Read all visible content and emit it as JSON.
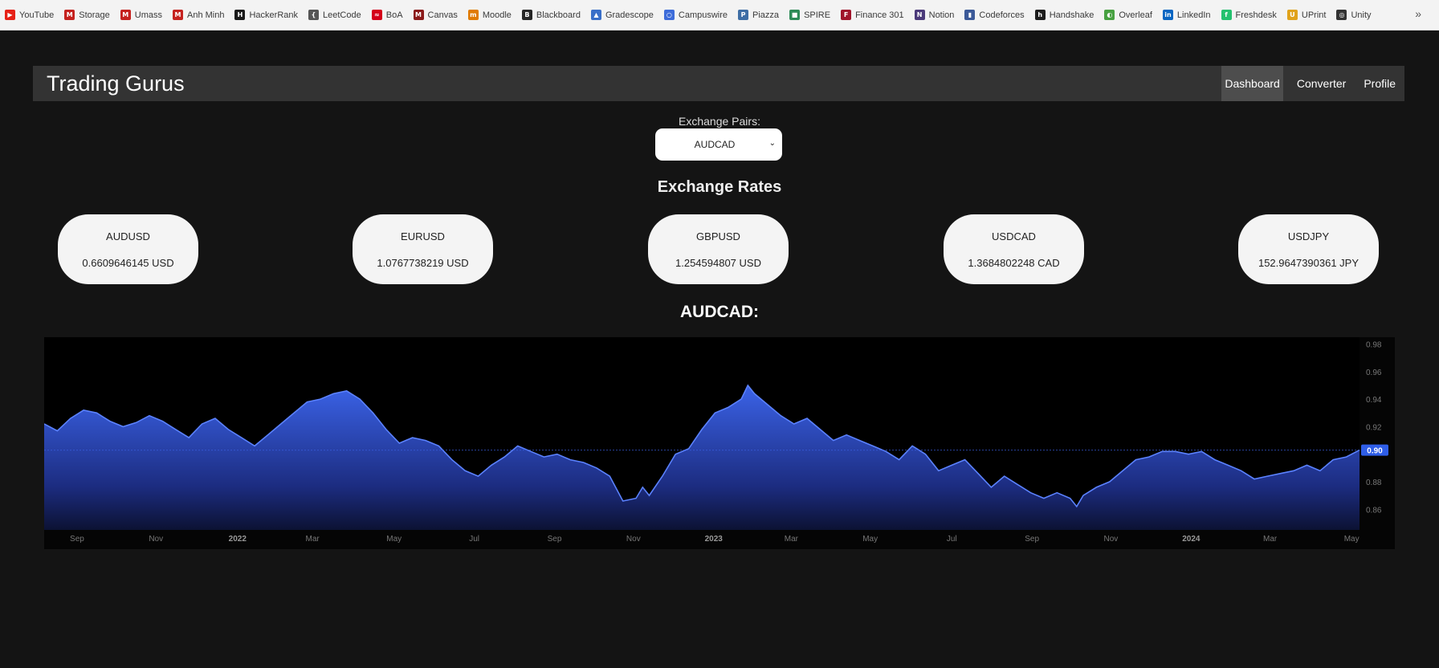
{
  "bookmarks": [
    {
      "label": "YouTube",
      "icon": "youtube-icon",
      "color": "#e62117",
      "glyph": "▶"
    },
    {
      "label": "Storage",
      "icon": "gmail-icon",
      "color": "#c5221f",
      "glyph": "M"
    },
    {
      "label": "Umass",
      "icon": "gmail-icon",
      "color": "#c5221f",
      "glyph": "M"
    },
    {
      "label": "Anh Minh",
      "icon": "gmail-icon",
      "color": "#c5221f",
      "glyph": "M"
    },
    {
      "label": "HackerRank",
      "icon": "hackerrank-icon",
      "color": "#1a1a1a",
      "glyph": "H"
    },
    {
      "label": "LeetCode",
      "icon": "leetcode-icon",
      "color": "#555555",
      "glyph": "{"
    },
    {
      "label": "BoA",
      "icon": "boa-icon",
      "color": "#d4001a",
      "glyph": "≈"
    },
    {
      "label": "Canvas",
      "icon": "canvas-icon",
      "color": "#8b1a1a",
      "glyph": "M"
    },
    {
      "label": "Moodle",
      "icon": "moodle-icon",
      "color": "#e07b00",
      "glyph": "m"
    },
    {
      "label": "Blackboard",
      "icon": "blackboard-icon",
      "color": "#262626",
      "glyph": "B"
    },
    {
      "label": "Gradescope",
      "icon": "gradescope-icon",
      "color": "#3a6fc8",
      "glyph": "▲"
    },
    {
      "label": "Campuswire",
      "icon": "campuswire-icon",
      "color": "#3d6cd9",
      "glyph": "○"
    },
    {
      "label": "Piazza",
      "icon": "piazza-icon",
      "color": "#3e6ea5",
      "glyph": "P"
    },
    {
      "label": "SPIRE",
      "icon": "spire-icon",
      "color": "#2e8b57",
      "glyph": "■"
    },
    {
      "label": "Finance 301",
      "icon": "finance-icon",
      "color": "#a0142b",
      "glyph": "F"
    },
    {
      "label": "Notion",
      "icon": "notion-icon",
      "color": "#4b3a7a",
      "glyph": "N"
    },
    {
      "label": "Codeforces",
      "icon": "codeforces-icon",
      "color": "#3b5998",
      "glyph": "▮"
    },
    {
      "label": "Handshake",
      "icon": "handshake-icon",
      "color": "#1d1d1d",
      "glyph": "h"
    },
    {
      "label": "Overleaf",
      "icon": "overleaf-icon",
      "color": "#47a141",
      "glyph": "◐"
    },
    {
      "label": "LinkedIn",
      "icon": "linkedin-icon",
      "color": "#0a66c2",
      "glyph": "in"
    },
    {
      "label": "Freshdesk",
      "icon": "freshdesk-icon",
      "color": "#25c16f",
      "glyph": "f"
    },
    {
      "label": "UPrint",
      "icon": "uprint-icon",
      "color": "#e0a21a",
      "glyph": "U"
    },
    {
      "label": "Unity",
      "icon": "unity-icon",
      "color": "#333333",
      "glyph": "◎"
    }
  ],
  "more_label": "»",
  "app": {
    "title": "Trading Gurus",
    "nav": [
      "Dashboard",
      "Converter",
      "Profile"
    ],
    "active_nav": "Dashboard"
  },
  "exchange": {
    "label": "Exchange Pairs:",
    "selected": "AUDCAD"
  },
  "rates_title": "Exchange Rates",
  "rates": [
    {
      "pair": "AUDUSD",
      "value": "0.6609646145 USD"
    },
    {
      "pair": "EURUSD",
      "value": "1.0767738219 USD"
    },
    {
      "pair": "GBPUSD",
      "value": "1.254594807 USD"
    },
    {
      "pair": "USDCAD",
      "value": "1.3684802248 CAD"
    },
    {
      "pair": "USDJPY",
      "value": "152.9647390361 JPY"
    }
  ],
  "chart_title": "AUDCAD:",
  "colors": {
    "accent": "#3b63e8",
    "line": "#5b82ff",
    "last_price_badge": "#2f5ee8"
  },
  "chart_data": {
    "type": "area",
    "title": "AUDCAD:",
    "ylim": [
      0.845,
      0.985
    ],
    "y_ticks": [
      0.86,
      0.88,
      0.9,
      0.92,
      0.94,
      0.96,
      0.98
    ],
    "y_tick_labels": [
      "0.86",
      "0.88",
      "",
      "0.92",
      "0.94",
      "0.96",
      "0.98"
    ],
    "last_value_label": "0.90",
    "last_value": 0.903,
    "x_ticks": [
      {
        "label": "Sep",
        "bold": false,
        "pos": 0.025
      },
      {
        "label": "Nov",
        "bold": false,
        "pos": 0.085
      },
      {
        "label": "2022",
        "bold": true,
        "pos": 0.147
      },
      {
        "label": "Mar",
        "bold": false,
        "pos": 0.204
      },
      {
        "label": "May",
        "bold": false,
        "pos": 0.266
      },
      {
        "label": "Jul",
        "bold": false,
        "pos": 0.327
      },
      {
        "label": "Sep",
        "bold": false,
        "pos": 0.388
      },
      {
        "label": "Nov",
        "bold": false,
        "pos": 0.448
      },
      {
        "label": "2023",
        "bold": true,
        "pos": 0.509
      },
      {
        "label": "Mar",
        "bold": false,
        "pos": 0.568
      },
      {
        "label": "May",
        "bold": false,
        "pos": 0.628
      },
      {
        "label": "Jul",
        "bold": false,
        "pos": 0.69
      },
      {
        "label": "Sep",
        "bold": false,
        "pos": 0.751
      },
      {
        "label": "Nov",
        "bold": false,
        "pos": 0.811
      },
      {
        "label": "2024",
        "bold": true,
        "pos": 0.872
      },
      {
        "label": "Mar",
        "bold": false,
        "pos": 0.932
      },
      {
        "label": "May",
        "bold": false,
        "pos": 0.994
      }
    ],
    "series": [
      {
        "values": [
          [
            0.0,
            0.922
          ],
          [
            0.01,
            0.917
          ],
          [
            0.02,
            0.926
          ],
          [
            0.03,
            0.932
          ],
          [
            0.04,
            0.93
          ],
          [
            0.05,
            0.924
          ],
          [
            0.06,
            0.92
          ],
          [
            0.07,
            0.923
          ],
          [
            0.08,
            0.928
          ],
          [
            0.09,
            0.924
          ],
          [
            0.1,
            0.918
          ],
          [
            0.11,
            0.912
          ],
          [
            0.12,
            0.922
          ],
          [
            0.13,
            0.926
          ],
          [
            0.14,
            0.918
          ],
          [
            0.15,
            0.912
          ],
          [
            0.16,
            0.906
          ],
          [
            0.17,
            0.914
          ],
          [
            0.18,
            0.922
          ],
          [
            0.19,
            0.93
          ],
          [
            0.2,
            0.938
          ],
          [
            0.21,
            0.94
          ],
          [
            0.22,
            0.944
          ],
          [
            0.23,
            0.946
          ],
          [
            0.24,
            0.94
          ],
          [
            0.25,
            0.93
          ],
          [
            0.26,
            0.918
          ],
          [
            0.27,
            0.908
          ],
          [
            0.28,
            0.912
          ],
          [
            0.29,
            0.91
          ],
          [
            0.3,
            0.906
          ],
          [
            0.31,
            0.896
          ],
          [
            0.32,
            0.888
          ],
          [
            0.33,
            0.884
          ],
          [
            0.34,
            0.892
          ],
          [
            0.35,
            0.898
          ],
          [
            0.36,
            0.906
          ],
          [
            0.37,
            0.902
          ],
          [
            0.38,
            0.898
          ],
          [
            0.39,
            0.9
          ],
          [
            0.4,
            0.896
          ],
          [
            0.41,
            0.894
          ],
          [
            0.42,
            0.89
          ],
          [
            0.43,
            0.884
          ],
          [
            0.44,
            0.866
          ],
          [
            0.45,
            0.868
          ],
          [
            0.455,
            0.876
          ],
          [
            0.46,
            0.87
          ],
          [
            0.47,
            0.884
          ],
          [
            0.48,
            0.9
          ],
          [
            0.49,
            0.904
          ],
          [
            0.5,
            0.918
          ],
          [
            0.51,
            0.93
          ],
          [
            0.52,
            0.934
          ],
          [
            0.53,
            0.94
          ],
          [
            0.535,
            0.95
          ],
          [
            0.54,
            0.944
          ],
          [
            0.55,
            0.936
          ],
          [
            0.56,
            0.928
          ],
          [
            0.57,
            0.922
          ],
          [
            0.58,
            0.926
          ],
          [
            0.59,
            0.918
          ],
          [
            0.6,
            0.91
          ],
          [
            0.61,
            0.914
          ],
          [
            0.62,
            0.91
          ],
          [
            0.63,
            0.906
          ],
          [
            0.64,
            0.902
          ],
          [
            0.65,
            0.896
          ],
          [
            0.66,
            0.906
          ],
          [
            0.67,
            0.9
          ],
          [
            0.68,
            0.888
          ],
          [
            0.69,
            0.892
          ],
          [
            0.7,
            0.896
          ],
          [
            0.71,
            0.886
          ],
          [
            0.72,
            0.876
          ],
          [
            0.73,
            0.884
          ],
          [
            0.74,
            0.878
          ],
          [
            0.75,
            0.872
          ],
          [
            0.76,
            0.868
          ],
          [
            0.77,
            0.872
          ],
          [
            0.78,
            0.868
          ],
          [
            0.785,
            0.862
          ],
          [
            0.79,
            0.87
          ],
          [
            0.8,
            0.876
          ],
          [
            0.81,
            0.88
          ],
          [
            0.82,
            0.888
          ],
          [
            0.83,
            0.896
          ],
          [
            0.84,
            0.898
          ],
          [
            0.85,
            0.902
          ],
          [
            0.86,
            0.902
          ],
          [
            0.87,
            0.9
          ],
          [
            0.88,
            0.902
          ],
          [
            0.89,
            0.896
          ],
          [
            0.9,
            0.892
          ],
          [
            0.91,
            0.888
          ],
          [
            0.92,
            0.882
          ],
          [
            0.93,
            0.884
          ],
          [
            0.94,
            0.886
          ],
          [
            0.95,
            0.888
          ],
          [
            0.96,
            0.892
          ],
          [
            0.97,
            0.888
          ],
          [
            0.98,
            0.896
          ],
          [
            0.99,
            0.898
          ],
          [
            1.0,
            0.903
          ]
        ]
      }
    ]
  }
}
